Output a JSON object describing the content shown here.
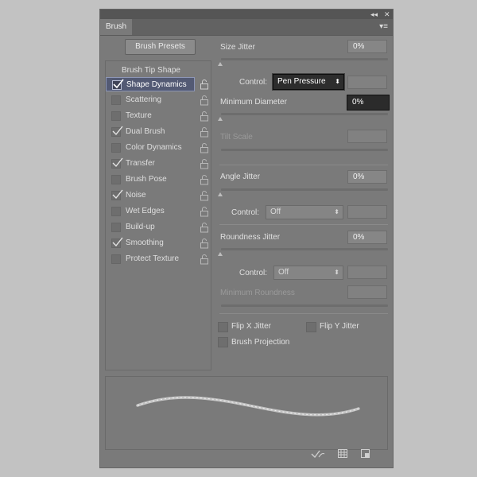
{
  "panel": {
    "tab_label": "Brush",
    "collapse_glyph": "◂◂",
    "close_glyph": "✕",
    "menu_glyph": "▾≡"
  },
  "presets_button": "Brush Presets",
  "left": {
    "header": "Brush Tip Shape",
    "items": [
      {
        "label": "Shape Dynamics",
        "checked": true,
        "selected": true
      },
      {
        "label": "Scattering",
        "checked": false
      },
      {
        "label": "Texture",
        "checked": false
      },
      {
        "label": "Dual Brush",
        "checked": true
      },
      {
        "label": "Color Dynamics",
        "checked": false
      },
      {
        "label": "Transfer",
        "checked": true
      },
      {
        "label": "Brush Pose",
        "checked": false
      },
      {
        "label": "Noise",
        "checked": true
      },
      {
        "label": "Wet Edges",
        "checked": false
      },
      {
        "label": "Build-up",
        "checked": false
      },
      {
        "label": "Smoothing",
        "checked": true
      },
      {
        "label": "Protect Texture",
        "checked": false
      }
    ]
  },
  "right": {
    "size_jitter": {
      "label": "Size Jitter",
      "value": "0%"
    },
    "size_control": {
      "label": "Control:",
      "value": "Pen Pressure"
    },
    "min_diameter": {
      "label": "Minimum Diameter",
      "value": "0%"
    },
    "tilt_scale": {
      "label": "Tilt Scale"
    },
    "angle_jitter": {
      "label": "Angle Jitter",
      "value": "0%"
    },
    "angle_control": {
      "label": "Control:",
      "value": "Off"
    },
    "roundness_jitter": {
      "label": "Roundness Jitter",
      "value": "0%"
    },
    "roundness_control": {
      "label": "Control:",
      "value": "Off"
    },
    "min_roundness": {
      "label": "Minimum Roundness"
    },
    "flip_x": "Flip X Jitter",
    "flip_y": "Flip Y Jitter",
    "projection": "Brush Projection"
  },
  "icons": {
    "lock": "lock-icon",
    "checkmark": "check-icon",
    "stroke_preview": "brush-stroke-preview",
    "footer": [
      "toggle-brush-icon",
      "grid-icon",
      "new-preset-icon"
    ]
  }
}
